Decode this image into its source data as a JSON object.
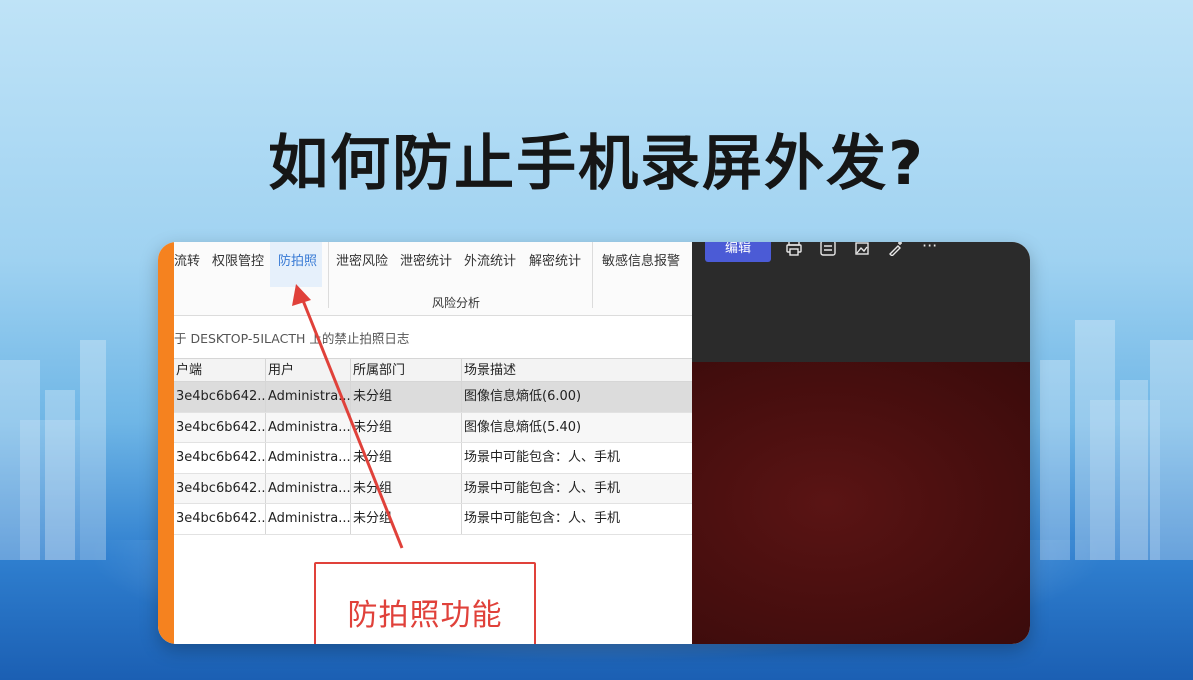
{
  "headline": "如何防止手机录屏外发?",
  "ribbon": {
    "items": [
      "流转",
      "权限管控",
      "防拍照",
      "泄密风险",
      "泄密统计",
      "外流统计",
      "解密统计",
      "敏感信息报警"
    ],
    "active_item": "防拍照",
    "group_label": "风险分析"
  },
  "subtitle": "于 DESKTOP-5ILACTH 上的禁止拍照日志",
  "table": {
    "columns": [
      "户端",
      "用户",
      "所属部门",
      "场景描述"
    ],
    "rows": [
      [
        "3e4bc6b642...",
        "Administra...",
        "未分组",
        "图像信息熵低(6.00)"
      ],
      [
        "3e4bc6b642...",
        "Administra...",
        "未分组",
        "图像信息熵低(5.40)"
      ],
      [
        "3e4bc6b642...",
        "Administra...",
        "未分组",
        "场景中可能包含：人、手机"
      ],
      [
        "3e4bc6b642...",
        "Administra...",
        "未分组",
        "场景中可能包含：人、手机"
      ],
      [
        "3e4bc6b642...",
        "Administra...",
        "未分组",
        "场景中可能包含：人、手机"
      ]
    ]
  },
  "viewer": {
    "edit_label": "编辑",
    "icons": [
      "print-icon",
      "share-icon",
      "crop-icon",
      "markup-icon",
      "more-icon"
    ],
    "more_label": "···"
  },
  "callout": {
    "text": "防拍照功能",
    "color": "#e0413a"
  },
  "colors": {
    "accent": "#4b5bd6",
    "orange": "#f5821f",
    "active": "#3a7bd5"
  }
}
